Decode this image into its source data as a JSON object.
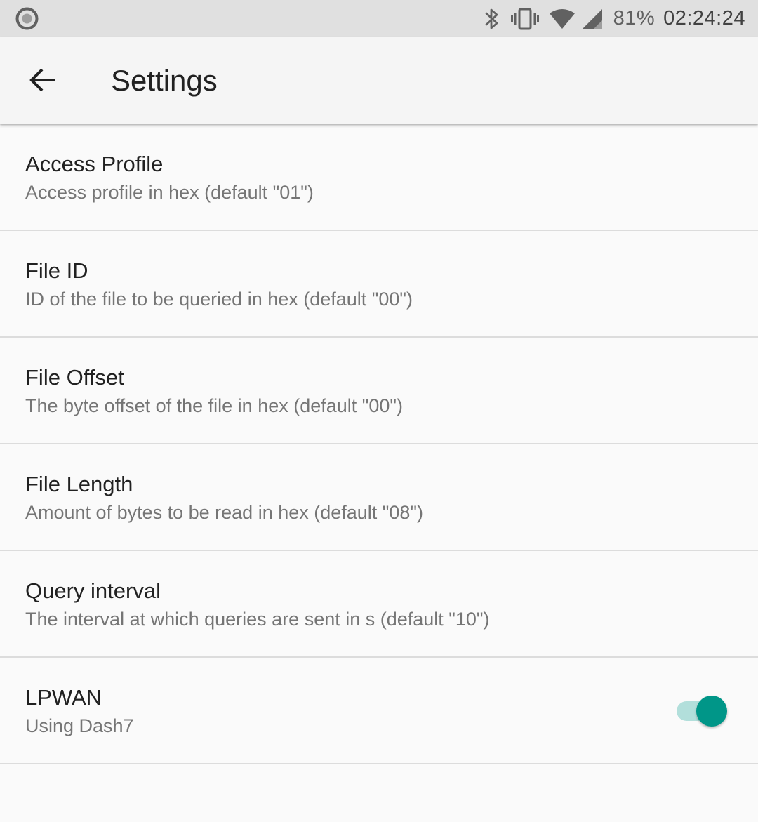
{
  "status_bar": {
    "left_icon": "notification-circle-icon",
    "icons": [
      "bluetooth-icon",
      "vibrate-icon",
      "wifi-icon",
      "cell-signal-icon"
    ],
    "battery": "81%",
    "time": "02:24:24"
  },
  "app_bar": {
    "back_icon": "arrow-back-icon",
    "title": "Settings"
  },
  "preferences": [
    {
      "title": "Access Profile",
      "summary": "Access profile in hex (default \"01\")"
    },
    {
      "title": "File ID",
      "summary": "ID of the file to be queried in hex (default \"00\")"
    },
    {
      "title": "File Offset",
      "summary": "The byte offset of the file in hex (default \"00\")"
    },
    {
      "title": "File Length",
      "summary": "Amount of bytes to be read in hex (default \"08\")"
    },
    {
      "title": "Query interval",
      "summary": "The interval at which queries are sent in s (default \"10\")"
    },
    {
      "title": "LPWAN",
      "summary": "Using Dash7",
      "switch": {
        "checked": true
      }
    }
  ],
  "colors": {
    "accent": "#009688",
    "accent_track": "#b2dfdb",
    "status_bar_bg": "#e0e0e0",
    "app_bar_bg": "#f5f5f5",
    "background": "#fafafa"
  }
}
